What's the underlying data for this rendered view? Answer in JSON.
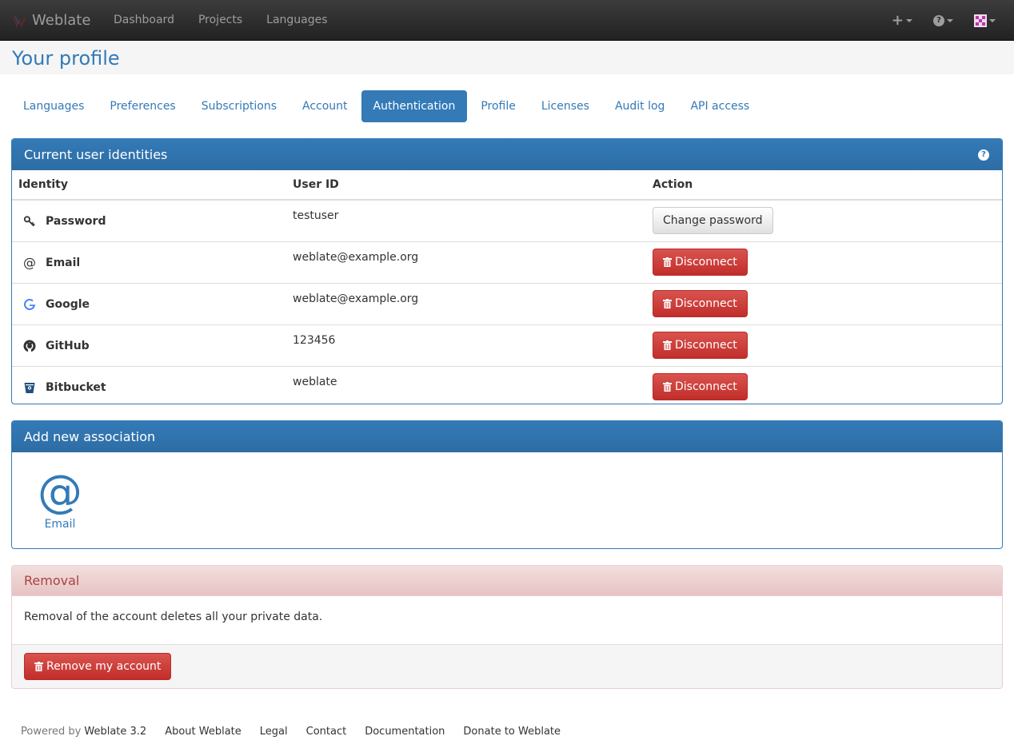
{
  "navbar": {
    "brand": "Weblate",
    "links": [
      "Dashboard",
      "Projects",
      "Languages"
    ]
  },
  "page": {
    "title": "Your profile"
  },
  "tabs": [
    {
      "label": "Languages"
    },
    {
      "label": "Preferences"
    },
    {
      "label": "Subscriptions"
    },
    {
      "label": "Account"
    },
    {
      "label": "Authentication",
      "active": true
    },
    {
      "label": "Profile"
    },
    {
      "label": "Licenses"
    },
    {
      "label": "Audit log"
    },
    {
      "label": "API access"
    }
  ],
  "identities": {
    "title": "Current user identities",
    "columns": [
      "Identity",
      "User ID",
      "Action"
    ],
    "rows": [
      {
        "identity": "Password",
        "icon": "key-icon",
        "user_id": "testuser",
        "action": "Change password"
      },
      {
        "identity": "Email",
        "icon": "at-icon",
        "user_id": "weblate@example.org",
        "action": "Disconnect"
      },
      {
        "identity": "Google",
        "icon": "google-icon",
        "user_id": "weblate@example.org",
        "action": "Disconnect"
      },
      {
        "identity": "GitHub",
        "icon": "github-icon",
        "user_id": "123456",
        "action": "Disconnect"
      },
      {
        "identity": "Bitbucket",
        "icon": "bitbucket-icon",
        "user_id": "weblate",
        "action": "Disconnect"
      }
    ]
  },
  "association": {
    "title": "Add new association",
    "items": [
      {
        "label": "Email",
        "icon": "at-icon"
      }
    ]
  },
  "removal": {
    "title": "Removal",
    "text": "Removal of the account deletes all your private data.",
    "button": "Remove my account"
  },
  "footer": {
    "powered_by": "Powered by",
    "version": "Weblate 3.2",
    "links": [
      "About Weblate",
      "Legal",
      "Contact",
      "Documentation",
      "Donate to Weblate"
    ]
  },
  "colors": {
    "primary": "#337ab7",
    "danger": "#d9534f",
    "navbar": "#222222"
  }
}
